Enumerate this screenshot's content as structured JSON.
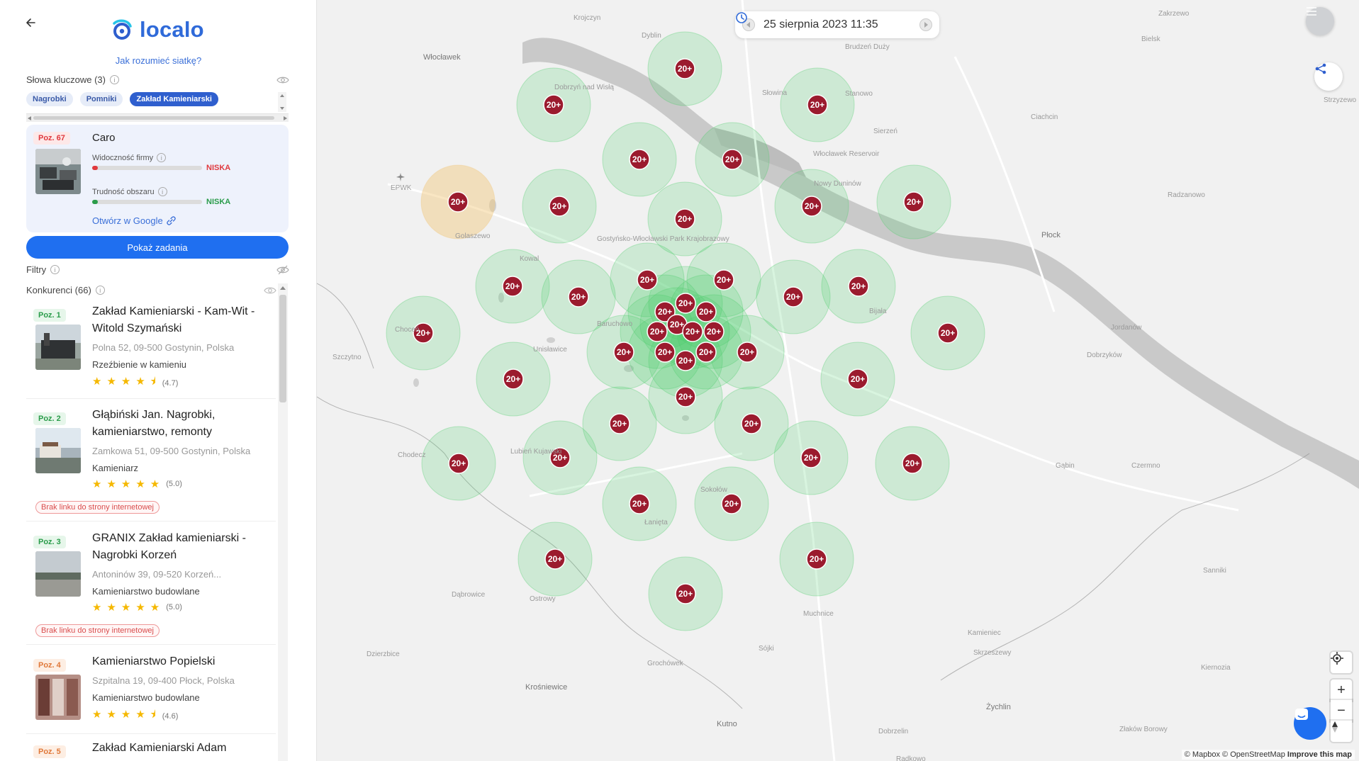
{
  "sidebar": {
    "logo_text": "localo",
    "grid_link": "Jak rozumieć siatkę?",
    "keywords_label": "Słowa kluczowe (3)",
    "keywords": [
      "Nagrobki",
      "Pomniki",
      "Zakład Kamieniarski"
    ],
    "active_keyword_index": 2,
    "my_business": {
      "position": "Poz. 67",
      "name": "Caro",
      "visibility_label": "Widoczność firmy",
      "visibility_level": "NISKA",
      "visibility_value": 0.05,
      "difficulty_label": "Trudność obszaru",
      "difficulty_level": "NISKA",
      "difficulty_value": 0.05,
      "open_google": "Otwórz w Google"
    },
    "show_tasks": "Pokaż zadania",
    "filters_label": "Filtry",
    "competitors_label": "Konkurenci (66)",
    "competitors": [
      {
        "position": "Poz. 1",
        "name": "Zakład Kamieniarski - Kam-Wit - Witold Szymański",
        "address": "Polna 52, 09-500 Gostynin, Polska",
        "category": "Rzeźbienie w kamieniu",
        "stars": "★★★★⯨",
        "rating": "(4.7)",
        "no_link": ""
      },
      {
        "position": "Poz. 2",
        "name": "Głąbiński Jan. Nagrobki, kamieniarstwo, remonty",
        "address": "Zamkowa 51, 09-500 Gostynin, Polska",
        "category": "Kamieniarz",
        "stars": "★★★★★",
        "rating": "(5.0)",
        "no_link": "Brak linku do strony internetowej"
      },
      {
        "position": "Poz. 3",
        "name": "GRANIX Zakład kamieniarski - Nagrobki Korzeń",
        "address": "Antoninów 39, 09-520 Korzeń...",
        "category": "Kamieniarstwo budowlane",
        "stars": "★★★★★",
        "rating": "(5.0)",
        "no_link": "Brak linku do strony internetowej"
      },
      {
        "position": "Poz. 4",
        "name": "Kamieniarstwo Popielski",
        "address": "Szpitalna 19, 09-400 Płock, Polska",
        "category": "Kamieniarstwo budowlane",
        "stars": "★★★★⯨",
        "rating": "(4.6)",
        "no_link": ""
      },
      {
        "position": "Poz. 5",
        "name": "Zakład Kamieniarski Adam",
        "address": "",
        "category": "",
        "stars": "",
        "rating": "",
        "no_link": ""
      }
    ]
  },
  "map": {
    "timestamp": "25 sierpnia 2023 11:35",
    "pin_label": "20+",
    "attribution_mapbox": "© Mapbox",
    "attribution_osm": "© OpenStreetMap",
    "improve": "Improve this map",
    "zoom_in": "+",
    "zoom_out": "−",
    "places": [
      "Włocławek",
      "Dobrzyń nad Wisłą",
      "Włocławek Reservoir",
      "Płock",
      "Kowal",
      "Gostyńsko-Włocławski Park Krajobrazowy",
      "Lubień Kujawski",
      "Gąbin",
      "Łanięta",
      "Kutno",
      "Żychlin",
      "Krośniewice",
      "Bielsk",
      "EPWK",
      "Dobrzyków",
      "Sanniki",
      "Kiernozia",
      "Chodecz",
      "Baruchowo",
      "Nowy Duninów",
      "Brudzeń Duży",
      "Radzanowo",
      "Ciachcin",
      "Zakrzewo",
      "Dyblin",
      "Krojczyn",
      "Słowina",
      "Sierzeń",
      "Stanowo",
      "Choceń",
      "Unisławice",
      "Szczytno",
      "Golaszewo",
      "Bijała",
      "Sokołów",
      "Dąbrowice",
      "Ostrowy",
      "Grochówek",
      "Dzierzbice",
      "Muchnice",
      "Kamieniec",
      "Skrzeszewy",
      "Czermno",
      "Jordanów",
      "Strzyzewo",
      "Dobrzelin",
      "Złaków Borowy",
      "Sójki",
      "Radkowo"
    ],
    "accent_green": "#4fcf6e",
    "accent_orange": "#f2c77b",
    "pin_color": "#9b1b2e"
  }
}
